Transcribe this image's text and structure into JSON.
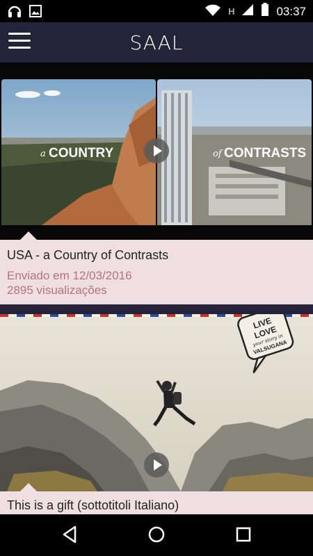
{
  "status_bar": {
    "time": "03:37",
    "network_letter": "H"
  },
  "app_bar": {
    "title": "SAAL",
    "menu_icon": "hamburger-menu-icon"
  },
  "videos": [
    {
      "title": "USA - a Country of Contrasts",
      "date": "Enviado em 12/03/2016",
      "views": "2895 visualizações",
      "thumb_text_left_small": "a",
      "thumb_text_left": "COUNTRY",
      "thumb_text_right_small": "of",
      "thumb_text_right": "CONTRASTS"
    },
    {
      "title": "This is a gift (sottotitoli Italiano)",
      "badge_line1": "LIVE",
      "badge_line2": "LOVE",
      "badge_line3": "your story in",
      "badge_line4": "VALSUGANA"
    }
  ],
  "colors": {
    "app_bar": "#25233a",
    "info_bg": "#efdfe2",
    "meta_text": "#b3737f",
    "title_text": "#222222"
  },
  "nav_icons": [
    "back-icon",
    "home-icon",
    "recents-icon"
  ]
}
